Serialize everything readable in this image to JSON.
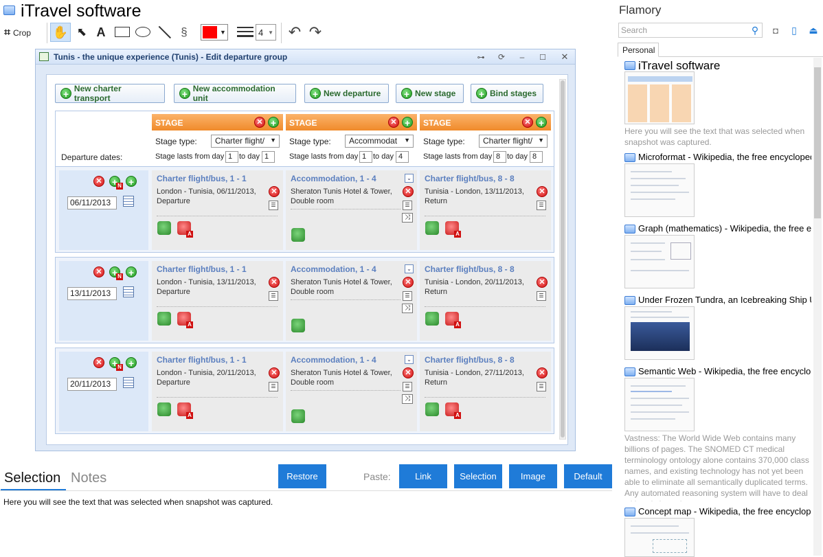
{
  "app": {
    "title": "iTravel software"
  },
  "toolbar": {
    "crop_label": "Crop",
    "line_width": "4",
    "color": "#ff0000"
  },
  "dialog": {
    "title": "Tunis - the unique experience (Tunis) - Edit departure group",
    "buttons": [
      "New charter transport",
      "New accommodation unit",
      "New departure",
      "New stage",
      "Bind stages"
    ],
    "departure_dates_label": "Departure dates:",
    "stages": [
      {
        "header": "STAGE",
        "type_label": "Stage type:",
        "type_value": "Charter flight/",
        "lasts_label": "Stage lasts  from day",
        "from_day": "1",
        "to_label": "to day",
        "to_day": "1"
      },
      {
        "header": "STAGE",
        "type_label": "Stage type:",
        "type_value": "Accommodat",
        "lasts_label": "Stage lasts  from day",
        "from_day": "1",
        "to_label": "to day",
        "to_day": "4"
      },
      {
        "header": "STAGE",
        "type_label": "Stage type:",
        "type_value": "Charter flight/",
        "lasts_label": "Stage lasts  from day",
        "from_day": "8",
        "to_label": "to day",
        "to_day": "8"
      }
    ],
    "departures": [
      {
        "date": "06/11/2013",
        "c1": {
          "title": "Charter flight/bus, 1 - 1",
          "line1": "London - Tunisia, 06/11/2013,",
          "line2": "Departure"
        },
        "c2": {
          "title": "Accommodation, 1 - 4",
          "line1": "Sheraton Tunis Hotel & Tower,",
          "line2": "Double room"
        },
        "c3": {
          "title": "Charter flight/bus, 8 - 8",
          "line1": "Tunisia - London, 13/11/2013,",
          "line2": "Return"
        }
      },
      {
        "date": "13/11/2013",
        "c1": {
          "title": "Charter flight/bus, 1 - 1",
          "line1": "London - Tunisia, 13/11/2013,",
          "line2": "Departure"
        },
        "c2": {
          "title": "Accommodation, 1 - 4",
          "line1": "Sheraton Tunis Hotel & Tower,",
          "line2": "Double room"
        },
        "c3": {
          "title": "Charter flight/bus, 8 - 8",
          "line1": "Tunisia - London, 20/11/2013,",
          "line2": "Return"
        }
      },
      {
        "date": "20/11/2013",
        "c1": {
          "title": "Charter flight/bus, 1 - 1",
          "line1": "London - Tunisia, 20/11/2013,",
          "line2": "Departure"
        },
        "c2": {
          "title": "Accommodation, 1 - 4",
          "line1": "Sheraton Tunis Hotel & Tower,",
          "line2": "Double room"
        },
        "c3": {
          "title": "Charter flight/bus, 8 - 8",
          "line1": "Tunisia - London, 27/11/2013,",
          "line2": "Return"
        }
      }
    ]
  },
  "bottom": {
    "tabs": [
      "Selection",
      "Notes"
    ],
    "restore": "Restore",
    "paste_label": "Paste:",
    "paste_buttons": [
      "Link",
      "Selection",
      "Image",
      "Default"
    ],
    "selection_text": "Here you will see the text that was selected when snapshot was captured."
  },
  "sidebar": {
    "title": "Flamory",
    "search_placeholder": "Search",
    "tab": "Personal",
    "snapshots": [
      {
        "title": "iTravel software",
        "desc": "Here you will see the text that was selected when snapshot was captured."
      },
      {
        "title": "Microformat - Wikipedia, the free encyclopedia"
      },
      {
        "title": "Graph (mathematics) - Wikipedia, the free encyclopedia"
      },
      {
        "title": "Under Frozen Tundra, an Icebreaking Ship Uncovers"
      },
      {
        "title": "Semantic Web - Wikipedia, the free encyclopedia",
        "desc": "Vastness: The World Wide Web contains many billions of pages. The SNOMED CT medical terminology ontology alone contains 370,000 class names, and existing technology has not yet been able to eliminate all semantically duplicated terms. Any automated reasoning system will have to deal with truly huge inputs."
      },
      {
        "title": "Concept map - Wikipedia, the free encyclopedia"
      }
    ]
  }
}
